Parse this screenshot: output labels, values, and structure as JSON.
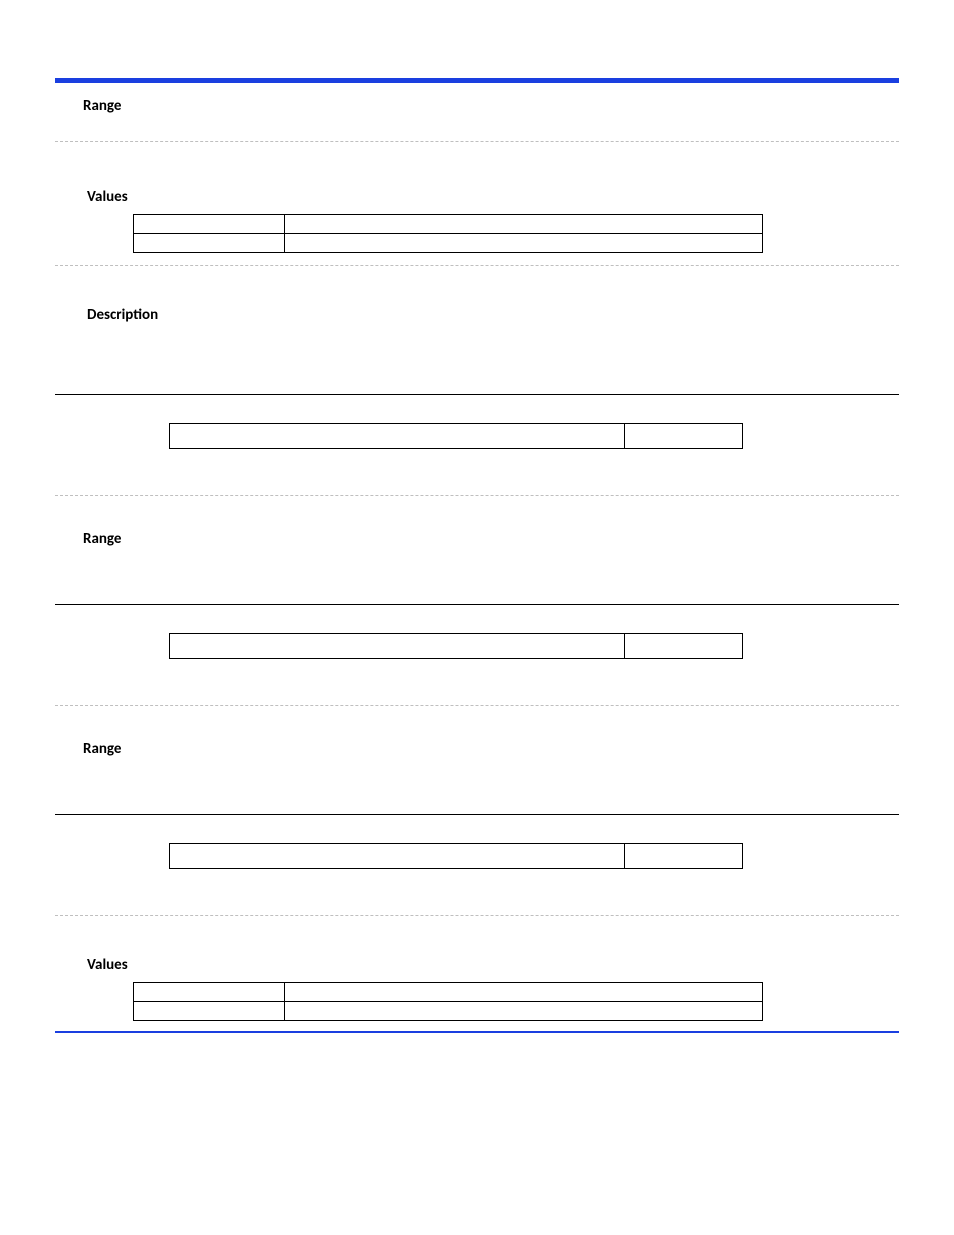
{
  "labels": {
    "range": "Range",
    "values": "Values",
    "description": "Description"
  },
  "values_tables": [
    {
      "rows": [
        {
          "c1": "",
          "c2": ""
        },
        {
          "c1": "",
          "c2": ""
        }
      ]
    },
    {
      "rows": [
        {
          "c1": "",
          "c2": ""
        },
        {
          "c1": "",
          "c2": ""
        }
      ]
    }
  ],
  "def_rows": [
    {
      "main": "",
      "side": ""
    },
    {
      "main": "",
      "side": ""
    },
    {
      "main": "",
      "side": ""
    }
  ]
}
